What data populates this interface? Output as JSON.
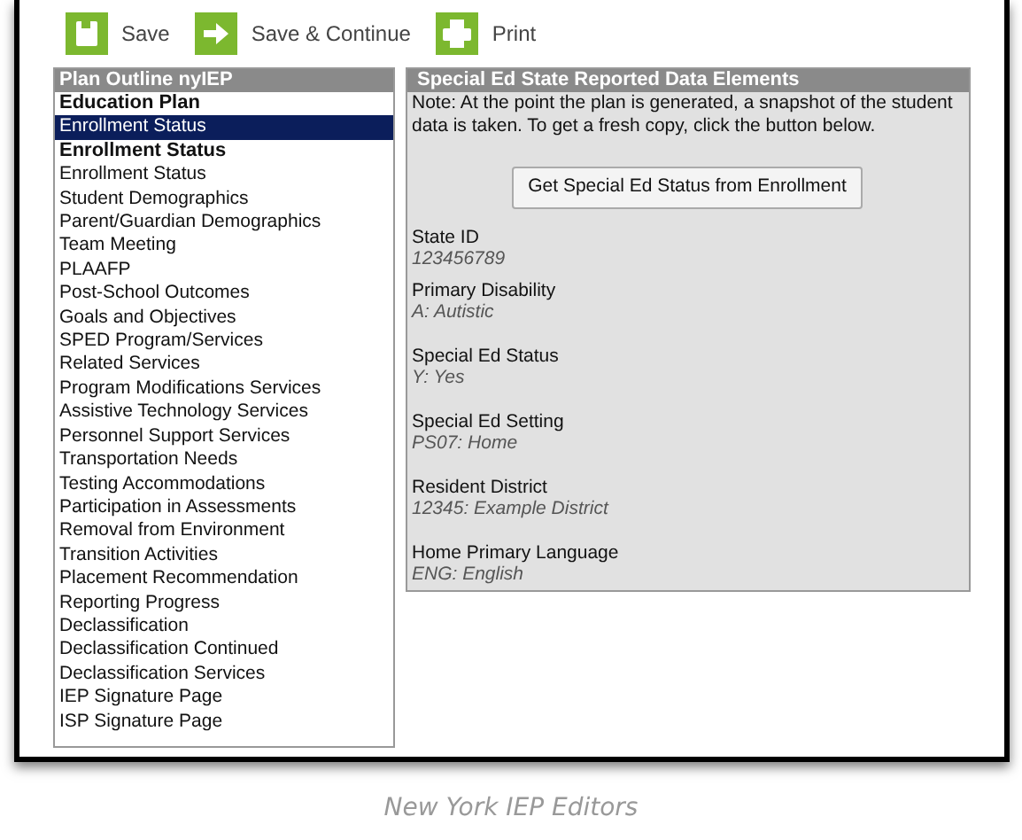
{
  "toolbar": [
    {
      "label": "Save",
      "kind": "save"
    },
    {
      "label": "Save & Continue",
      "kind": "continue"
    },
    {
      "label": "Print",
      "kind": "print"
    }
  ],
  "outline": {
    "title": "Plan Outline nyIEP",
    "items": [
      {
        "label": "Education Plan",
        "kind": "heading",
        "selected": false
      },
      {
        "label": "Enrollment Status",
        "kind": "item",
        "selected": true
      },
      {
        "label": "Enrollment Status",
        "kind": "heading",
        "selected": false
      },
      {
        "label": "Enrollment Status",
        "kind": "item",
        "selected": false
      },
      {
        "label": "Student Demographics",
        "kind": "item",
        "selected": false
      },
      {
        "label": "Parent/Guardian Demographics",
        "kind": "item",
        "selected": false
      },
      {
        "label": "Team Meeting",
        "kind": "item",
        "selected": false
      },
      {
        "label": "PLAAFP",
        "kind": "item",
        "selected": false
      },
      {
        "label": "Post-School Outcomes",
        "kind": "item",
        "selected": false
      },
      {
        "label": "Goals and Objectives",
        "kind": "item",
        "selected": false
      },
      {
        "label": "SPED Program/Services",
        "kind": "item",
        "selected": false
      },
      {
        "label": "Related Services",
        "kind": "item",
        "selected": false
      },
      {
        "label": "Program Modifications Services",
        "kind": "item",
        "selected": false
      },
      {
        "label": "Assistive Technology Services",
        "kind": "item",
        "selected": false
      },
      {
        "label": "Personnel Support Services",
        "kind": "item",
        "selected": false
      },
      {
        "label": "Transportation Needs",
        "kind": "item",
        "selected": false
      },
      {
        "label": "Testing Accommodations",
        "kind": "item",
        "selected": false
      },
      {
        "label": "Participation in Assessments",
        "kind": "item",
        "selected": false
      },
      {
        "label": "Removal from Environment",
        "kind": "item",
        "selected": false
      },
      {
        "label": "Transition Activities",
        "kind": "item",
        "selected": false
      },
      {
        "label": "Placement Recommendation",
        "kind": "item",
        "selected": false
      },
      {
        "label": "Reporting Progress",
        "kind": "item",
        "selected": false
      },
      {
        "label": "Declassification",
        "kind": "item",
        "selected": false
      },
      {
        "label": "Declassification Continued",
        "kind": "item",
        "selected": false
      },
      {
        "label": "Declassification Services",
        "kind": "item",
        "selected": false
      },
      {
        "label": "IEP Signature Page",
        "kind": "item",
        "selected": false
      },
      {
        "label": "ISP Signature Page",
        "kind": "item",
        "selected": false
      }
    ]
  },
  "panel": {
    "title": "Special Ed State Reported Data Elements",
    "note": "Note: At the point the plan is generated, a snapshot of the student data is taken. To get a fresh copy, click the button below.",
    "button": "Get Special Ed Status from Enrollment",
    "fields": [
      {
        "label": "State ID",
        "value": "123456789"
      },
      {
        "label": "Primary Disability",
        "value": "A: Autistic"
      },
      {
        "label": "Special Ed Status",
        "value": "Y: Yes"
      },
      {
        "label": "Special Ed Setting",
        "value": "PS07: Home"
      },
      {
        "label": "Resident District",
        "value": "12345: Example District"
      },
      {
        "label": "Home Primary Language",
        "value": "ENG: English"
      }
    ]
  },
  "caption": "New York IEP Editors"
}
